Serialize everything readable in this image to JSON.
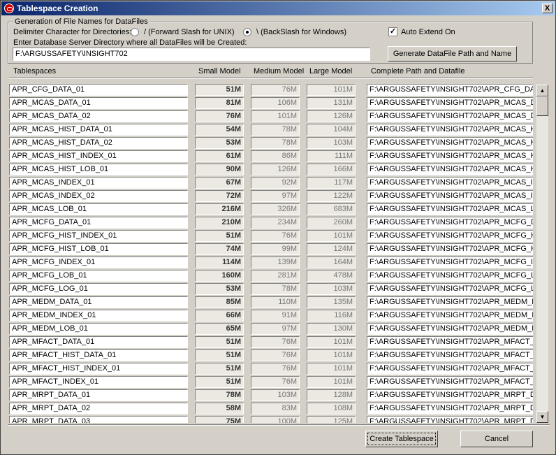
{
  "window": {
    "title": "Tablespace Creation",
    "close_label": "X"
  },
  "group": {
    "legend": "Generation of File Names for DataFiles",
    "delimiter_label": "Delimiter Character for Directories:",
    "radio_unix_label": "/ (Forward Slash for UNIX)",
    "radio_windows_label": "\\ (BackSlash for Windows)",
    "auto_extend_label": "Auto Extend On",
    "auto_extend_checked": true,
    "dir_prompt": "Enter Database Server Directory where all DataFiles will be Created:",
    "dir_value": "F:\\ARGUSSAFETY\\INSIGHT702",
    "generate_button": "Generate DataFile Path and Name"
  },
  "columns": {
    "tablespaces": "Tablespaces",
    "small": "Small Model",
    "medium": "Medium Model",
    "large": "Large Model",
    "path": "Complete Path and Datafile"
  },
  "rows": [
    {
      "name": "APR_CFG_DATA_01",
      "small": "51M",
      "medium": "76M",
      "large": "101M",
      "path": "F:\\ARGUSSAFETY\\INSIGHT702\\APR_CFG_DA"
    },
    {
      "name": "APR_MCAS_DATA_01",
      "small": "81M",
      "medium": "106M",
      "large": "131M",
      "path": "F:\\ARGUSSAFETY\\INSIGHT702\\APR_MCAS_D"
    },
    {
      "name": "APR_MCAS_DATA_02",
      "small": "76M",
      "medium": "101M",
      "large": "126M",
      "path": "F:\\ARGUSSAFETY\\INSIGHT702\\APR_MCAS_D"
    },
    {
      "name": "APR_MCAS_HIST_DATA_01",
      "small": "54M",
      "medium": "78M",
      "large": "104M",
      "path": "F:\\ARGUSSAFETY\\INSIGHT702\\APR_MCAS_H"
    },
    {
      "name": "APR_MCAS_HIST_DATA_02",
      "small": "53M",
      "medium": "78M",
      "large": "103M",
      "path": "F:\\ARGUSSAFETY\\INSIGHT702\\APR_MCAS_H"
    },
    {
      "name": "APR_MCAS_HIST_INDEX_01",
      "small": "61M",
      "medium": "86M",
      "large": "111M",
      "path": "F:\\ARGUSSAFETY\\INSIGHT702\\APR_MCAS_H"
    },
    {
      "name": "APR_MCAS_HIST_LOB_01",
      "small": "90M",
      "medium": "126M",
      "large": "166M",
      "path": "F:\\ARGUSSAFETY\\INSIGHT702\\APR_MCAS_H"
    },
    {
      "name": "APR_MCAS_INDEX_01",
      "small": "67M",
      "medium": "92M",
      "large": "117M",
      "path": "F:\\ARGUSSAFETY\\INSIGHT702\\APR_MCAS_IN"
    },
    {
      "name": "APR_MCAS_INDEX_02",
      "small": "72M",
      "medium": "97M",
      "large": "122M",
      "path": "F:\\ARGUSSAFETY\\INSIGHT702\\APR_MCAS_IN"
    },
    {
      "name": "APR_MCAS_LOB_01",
      "small": "216M",
      "medium": "326M",
      "large": "683M",
      "path": "F:\\ARGUSSAFETY\\INSIGHT702\\APR_MCAS_L"
    },
    {
      "name": "APR_MCFG_DATA_01",
      "small": "210M",
      "medium": "234M",
      "large": "260M",
      "path": "F:\\ARGUSSAFETY\\INSIGHT702\\APR_MCFG_D"
    },
    {
      "name": "APR_MCFG_HIST_INDEX_01",
      "small": "51M",
      "medium": "76M",
      "large": "101M",
      "path": "F:\\ARGUSSAFETY\\INSIGHT702\\APR_MCFG_H"
    },
    {
      "name": "APR_MCFG_HIST_LOB_01",
      "small": "74M",
      "medium": "99M",
      "large": "124M",
      "path": "F:\\ARGUSSAFETY\\INSIGHT702\\APR_MCFG_H"
    },
    {
      "name": "APR_MCFG_INDEX_01",
      "small": "114M",
      "medium": "139M",
      "large": "164M",
      "path": "F:\\ARGUSSAFETY\\INSIGHT702\\APR_MCFG_IN"
    },
    {
      "name": "APR_MCFG_LOB_01",
      "small": "160M",
      "medium": "281M",
      "large": "478M",
      "path": "F:\\ARGUSSAFETY\\INSIGHT702\\APR_MCFG_L"
    },
    {
      "name": "APR_MCFG_LOG_01",
      "small": "53M",
      "medium": "78M",
      "large": "103M",
      "path": "F:\\ARGUSSAFETY\\INSIGHT702\\APR_MCFG_L"
    },
    {
      "name": "APR_MEDM_DATA_01",
      "small": "85M",
      "medium": "110M",
      "large": "135M",
      "path": "F:\\ARGUSSAFETY\\INSIGHT702\\APR_MEDM_D"
    },
    {
      "name": "APR_MEDM_INDEX_01",
      "small": "66M",
      "medium": "91M",
      "large": "116M",
      "path": "F:\\ARGUSSAFETY\\INSIGHT702\\APR_MEDM_I"
    },
    {
      "name": "APR_MEDM_LOB_01",
      "small": "65M",
      "medium": "97M",
      "large": "130M",
      "path": "F:\\ARGUSSAFETY\\INSIGHT702\\APR_MEDM_L"
    },
    {
      "name": "APR_MFACT_DATA_01",
      "small": "51M",
      "medium": "76M",
      "large": "101M",
      "path": "F:\\ARGUSSAFETY\\INSIGHT702\\APR_MFACT_"
    },
    {
      "name": "APR_MFACT_HIST_DATA_01",
      "small": "51M",
      "medium": "76M",
      "large": "101M",
      "path": "F:\\ARGUSSAFETY\\INSIGHT702\\APR_MFACT_"
    },
    {
      "name": "APR_MFACT_HIST_INDEX_01",
      "small": "51M",
      "medium": "76M",
      "large": "101M",
      "path": "F:\\ARGUSSAFETY\\INSIGHT702\\APR_MFACT_"
    },
    {
      "name": "APR_MFACT_INDEX_01",
      "small": "51M",
      "medium": "76M",
      "large": "101M",
      "path": "F:\\ARGUSSAFETY\\INSIGHT702\\APR_MFACT_"
    },
    {
      "name": "APR_MRPT_DATA_01",
      "small": "78M",
      "medium": "103M",
      "large": "128M",
      "path": "F:\\ARGUSSAFETY\\INSIGHT702\\APR_MRPT_D"
    },
    {
      "name": "APR_MRPT_DATA_02",
      "small": "58M",
      "medium": "83M",
      "large": "108M",
      "path": "F:\\ARGUSSAFETY\\INSIGHT702\\APR_MRPT_D"
    },
    {
      "name": "APR_MRPT_DATA_03",
      "small": "75M",
      "medium": "100M",
      "large": "125M",
      "path": "F:\\ARGUSSAFETY\\INSIGHT702\\APR_MRPT_D"
    }
  ],
  "buttons": {
    "create": "Create Tablespace",
    "cancel": "Cancel"
  },
  "icons": {
    "app": "oracle-icon",
    "close": "close-icon",
    "scroll_up": "arrow-up-icon",
    "scroll_down": "arrow-down-icon"
  },
  "colors": {
    "title_start": "#0a246a",
    "title_end": "#a6caf0",
    "face": "#d4d0c8"
  }
}
